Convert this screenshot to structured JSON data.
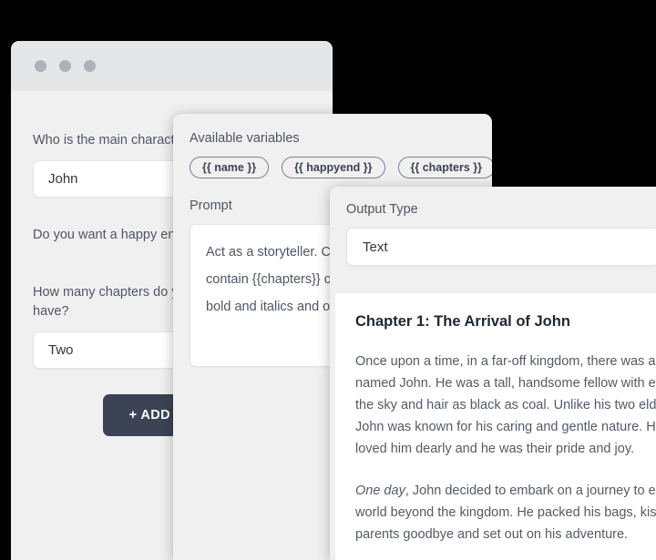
{
  "window_chrome": {
    "dots": [
      "close-dot",
      "minimize-dot",
      "maximize-dot"
    ]
  },
  "form_panel": {
    "fields": [
      {
        "label": "Who is the main character of your story?",
        "value": "John",
        "type": "text"
      },
      {
        "label": "Do you want a happy ending?",
        "value": "",
        "type": "text"
      },
      {
        "label": "How many chapters do you want your story to have?",
        "value": "Two",
        "type": "select"
      }
    ],
    "add_button_label": "+ ADD FIELD"
  },
  "prompt_panel": {
    "variables_label": "Available variables",
    "variables": [
      "{{ name }}",
      "{{ happyend }}",
      "{{ chapters }}"
    ],
    "prompt_label": "Prompt",
    "prompt_lines": [
      "Act as a storyteller. Create a story that must",
      "contain {{chapters}} chapters. Use markdown with",
      "bold and italics and optionally headings."
    ]
  },
  "output_panel": {
    "output_type_label": "Output Type",
    "output_type_value": "Text",
    "story": {
      "heading": "Chapter 1: The Arrival of John",
      "paragraph_1_lines": [
        "Once upon a time, in a far-off kingdom, there was a boy",
        "named John. He was a tall, handsome fellow with eyes as blue as",
        "the sky and hair as black as coal. Unlike his two elder brothers,",
        "John was known for his caring and gentle nature. His parents",
        "loved him dearly and he was their pride and joy."
      ],
      "paragraph_2_italic_lead": "One day",
      "paragraph_2_lines": [
        ", John decided to embark on a journey to explore the",
        "world beyond the kingdom. He packed his bags, kissed his",
        "parents goodbye and set out on his adventure."
      ]
    }
  },
  "colors": {
    "background": "#000000",
    "panel_bg": "#f0f0f0",
    "titlebar_bg": "#e4e6e7",
    "dot": "#aeb1b9",
    "input_bg": "#ffffff",
    "input_border": "#e3e4e8",
    "label_text": "#4f5563",
    "value_text": "#2f3543",
    "accent_button": "#3b4354",
    "pill_border": "#7b8192",
    "story_text": "#545a68",
    "story_heading": "#1f2633"
  }
}
